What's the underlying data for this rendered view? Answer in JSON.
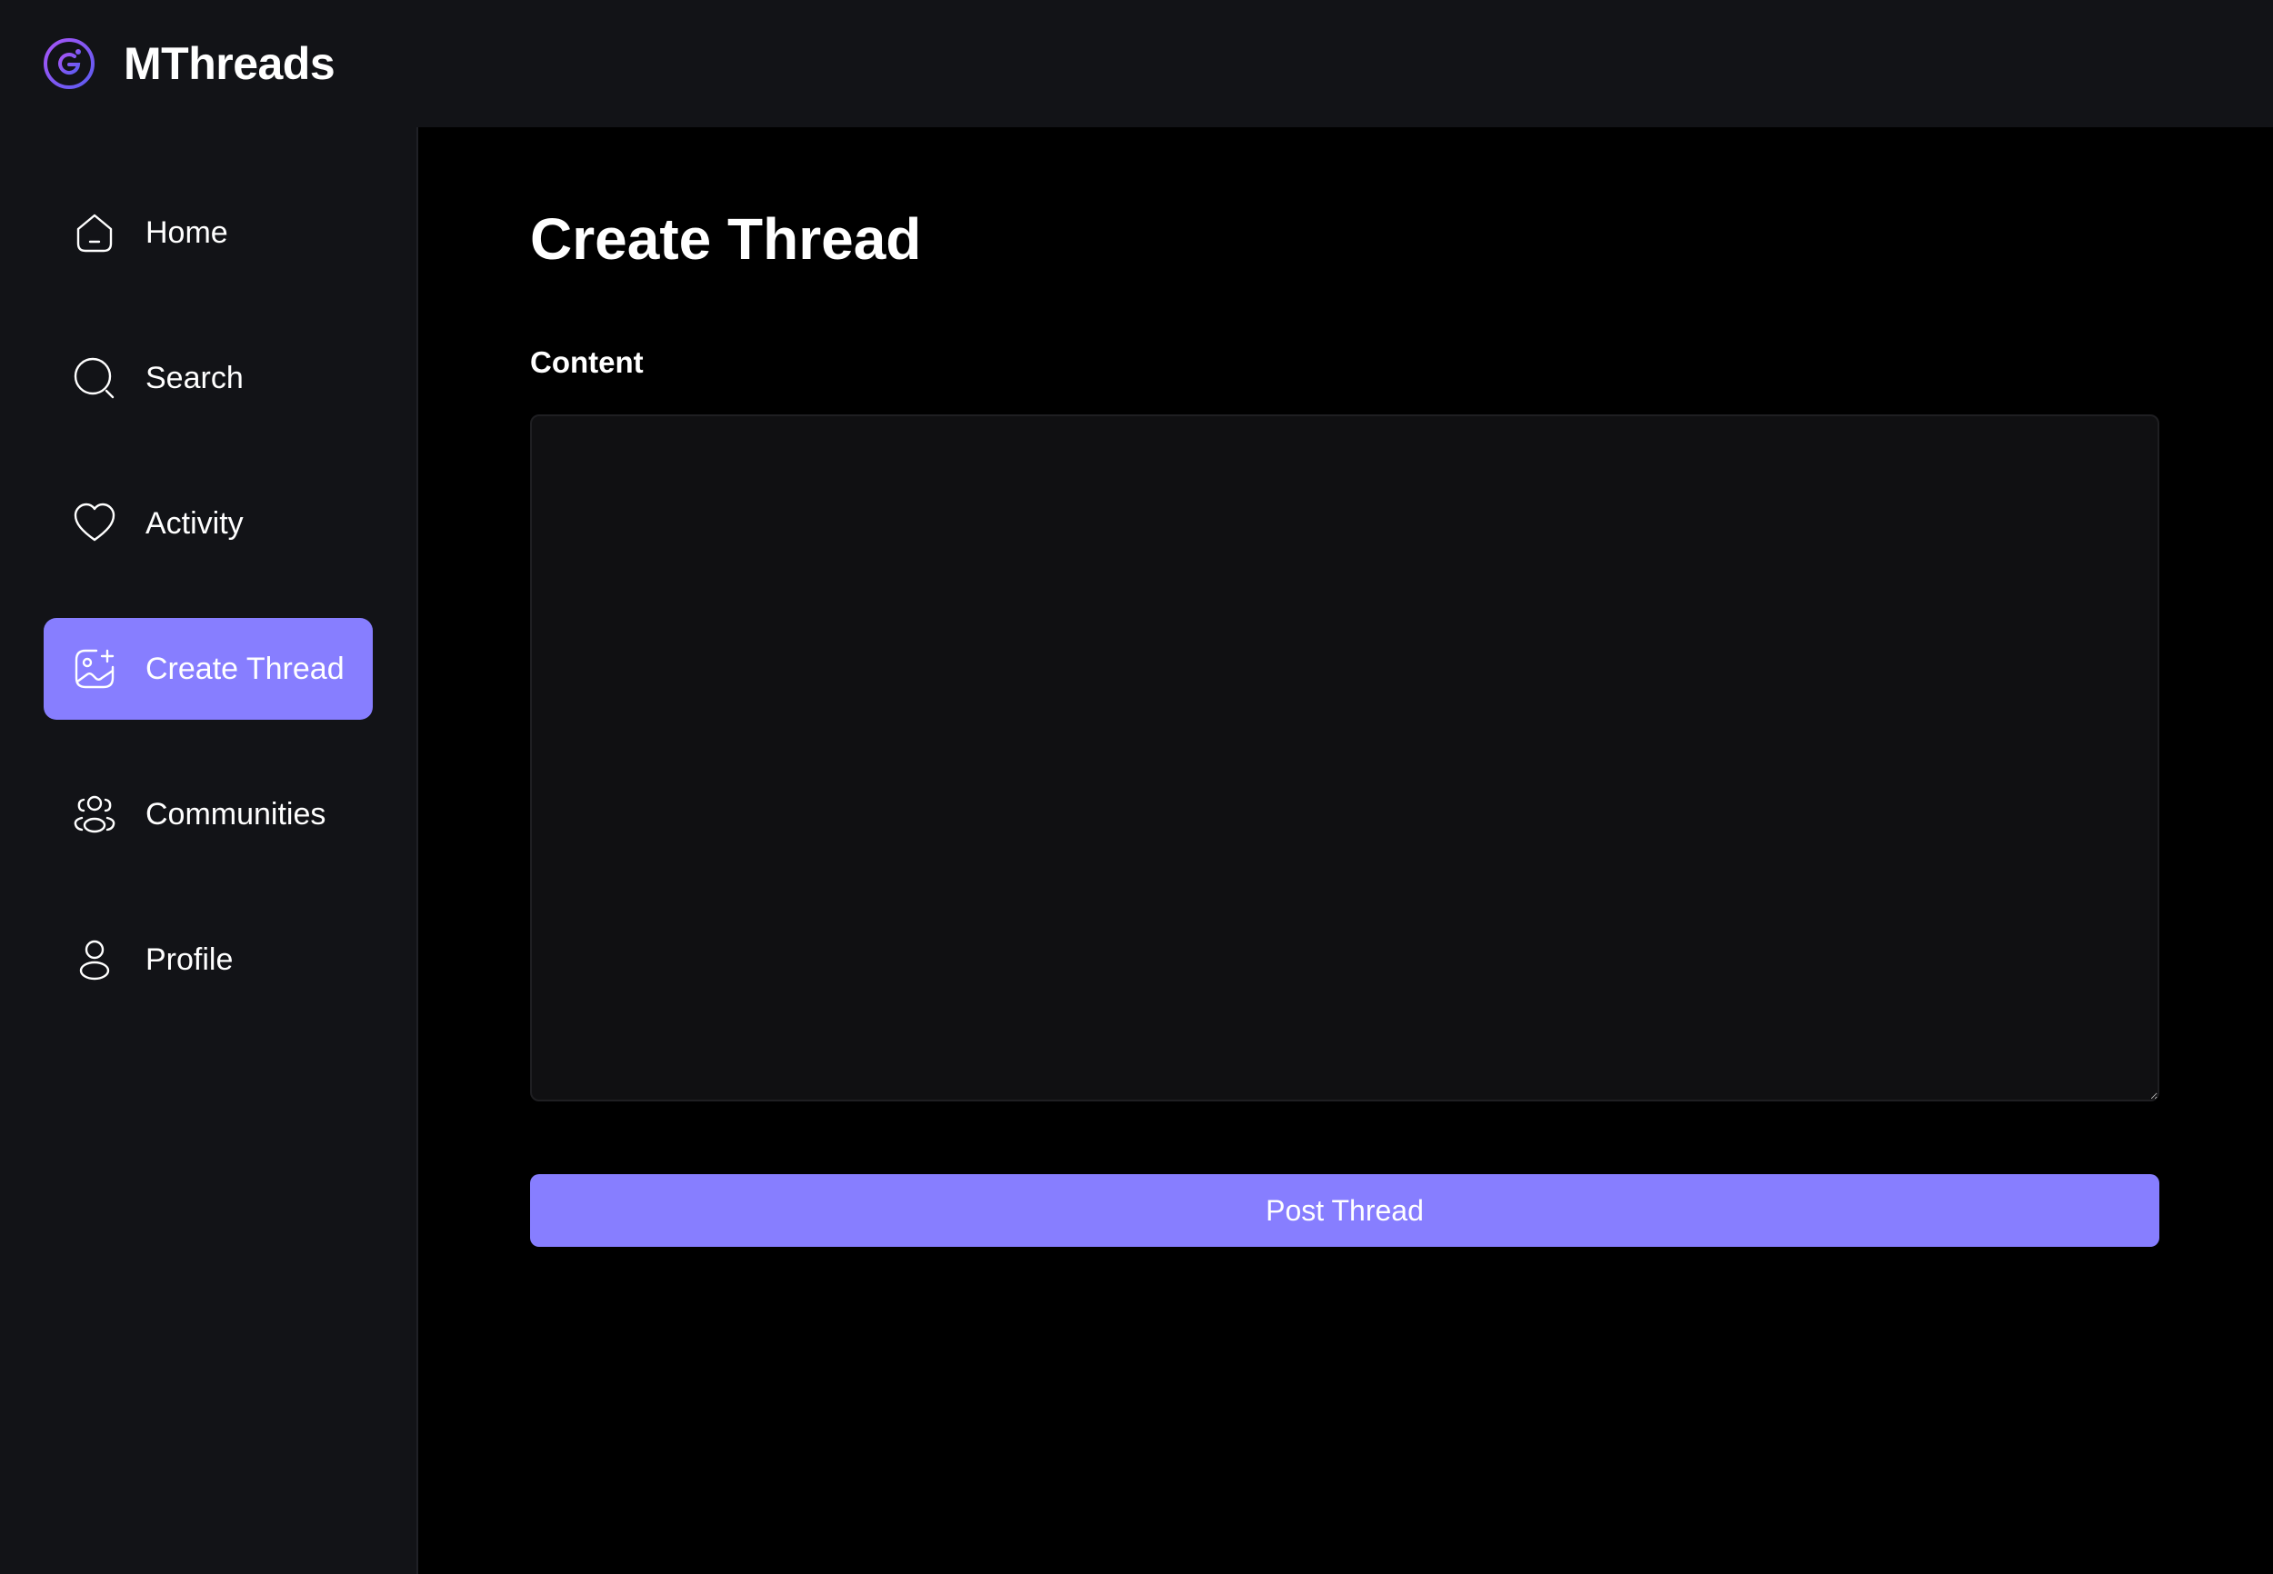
{
  "app": {
    "brand": "MThreads",
    "logo_icon": "logo-icon"
  },
  "colors": {
    "accent": "#877eff",
    "topbar_bg": "#121317",
    "sidebar_bg": "#121317",
    "main_bg": "#000000",
    "textarea_bg": "#101012",
    "text": "#ffffff"
  },
  "sidebar": {
    "items": [
      {
        "label": "Home",
        "icon": "home-icon",
        "active": false
      },
      {
        "label": "Search",
        "icon": "search-icon",
        "active": false
      },
      {
        "label": "Activity",
        "icon": "heart-icon",
        "active": false
      },
      {
        "label": "Create Thread",
        "icon": "gallery-add-icon",
        "active": true
      },
      {
        "label": "Communities",
        "icon": "users-icon",
        "active": false
      },
      {
        "label": "Profile",
        "icon": "user-icon",
        "active": false
      }
    ]
  },
  "main": {
    "title": "Create Thread",
    "content_label": "Content",
    "content_value": "",
    "submit_label": "Post Thread"
  }
}
